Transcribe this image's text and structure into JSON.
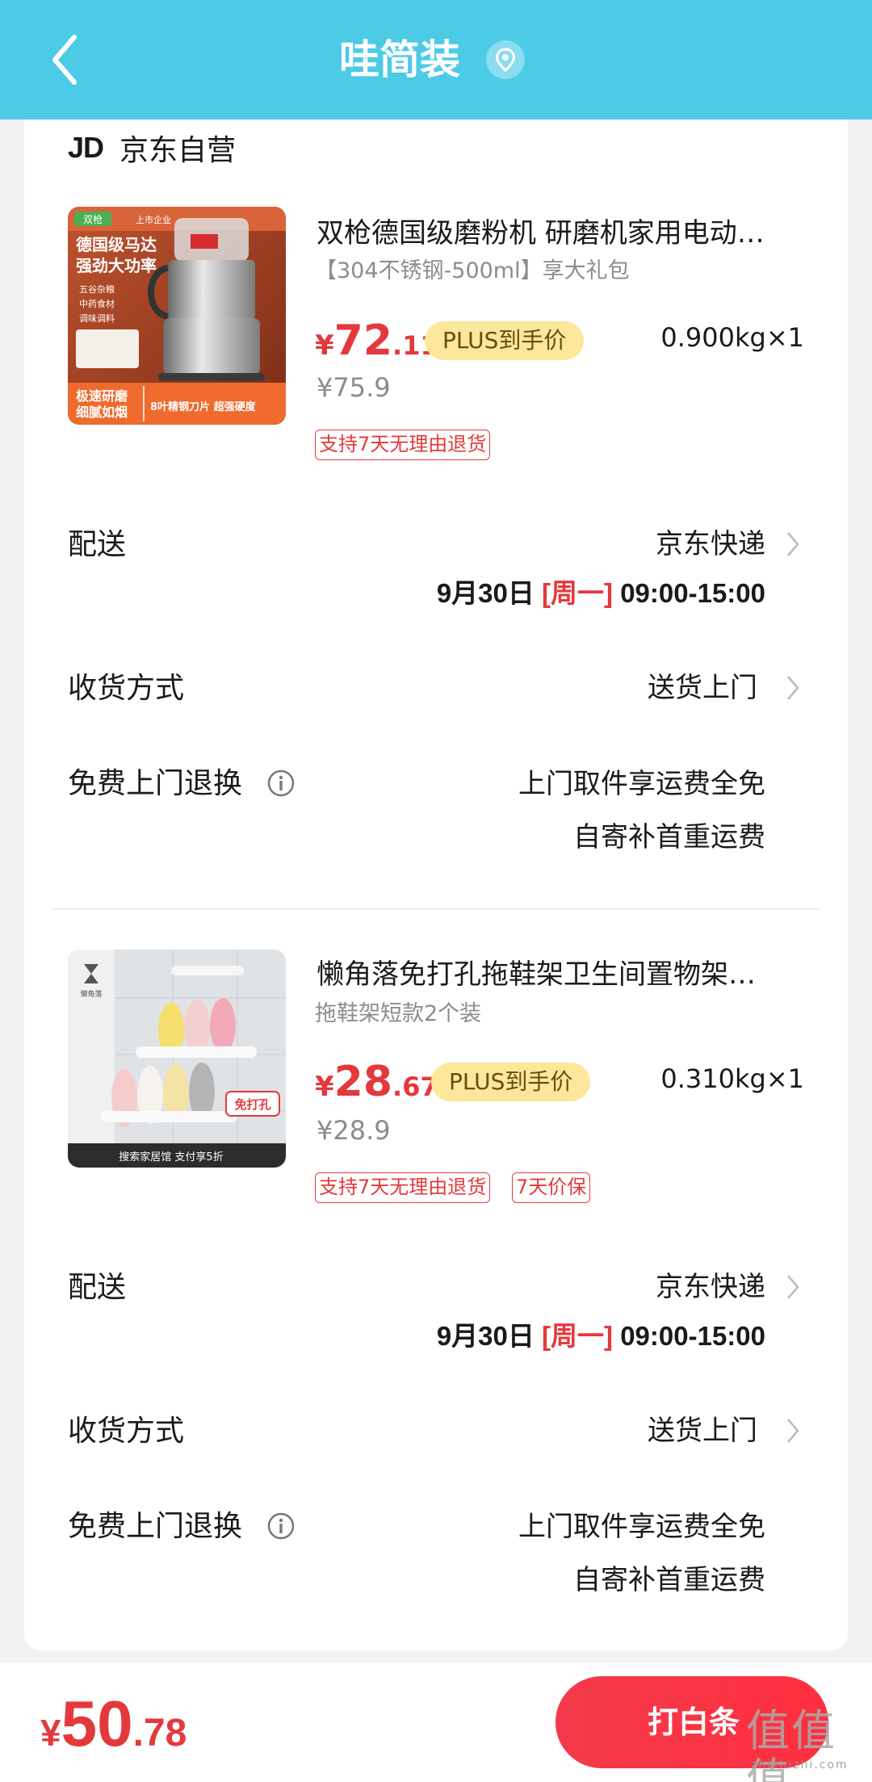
{
  "header": {
    "title": "哇简装",
    "back_icon": "chevron-left-icon",
    "location_icon": "location-pin-icon",
    "background_color": "#4ccbe6"
  },
  "shop": {
    "logo_text": "JD",
    "name": "京东自营"
  },
  "products": [
    {
      "title": "双枪德国级磨粉机 研磨机家用电动…",
      "spec": "【304不锈钢-500ml】享大礼包",
      "price_currency": "¥",
      "price_int": "72",
      "price_dec": ".11",
      "plus_badge": "PLUS到手价",
      "original_price": "¥75.9",
      "weight_qty": "0.900kg×1",
      "tags": [
        "支持7天无理由退货"
      ],
      "image_texts": {
        "brand": "双枪",
        "corner": "上市企业",
        "headline_1": "德国级马达",
        "headline_2": "强劲大功率",
        "features": [
          "五谷杂粮",
          "中药食材",
          "调味调料"
        ],
        "footer_left_1": "极速研磨",
        "footer_left_2": "细腻如烟",
        "footer_right": "8叶精钢刀片 超强硬度"
      },
      "delivery": {
        "label": "配送",
        "carrier": "京东快递",
        "date": "9月30日 ",
        "weekday": "[周一]",
        "time": " 09:00-15:00"
      },
      "receive": {
        "label": "收货方式",
        "value": "送货上门"
      },
      "free_return": {
        "label": "免费上门退换",
        "line1": "上门取件享运费全免",
        "line2": "自寄补首重运费"
      }
    },
    {
      "title": "懒角落免打孔拖鞋架卫生间置物架…",
      "spec": "拖鞋架短款2个装",
      "price_currency": "¥",
      "price_int": "28",
      "price_dec": ".67",
      "plus_badge": "PLUS到手价",
      "original_price": "¥28.9",
      "weight_qty": "0.310kg×1",
      "tags": [
        "支持7天无理由退货",
        "7天价保"
      ],
      "image_texts": {
        "brand": "懒角落",
        "sticker": "免打孔",
        "footer": "搜索家居馆 支付享5折"
      },
      "delivery": {
        "label": "配送",
        "carrier": "京东快递",
        "date": "9月30日 ",
        "weekday": "[周一]",
        "time": " 09:00-15:00"
      },
      "receive": {
        "label": "收货方式",
        "value": "送货上门"
      },
      "free_return": {
        "label": "免费上门退换",
        "line1": "上门取件享运费全免",
        "line2": "自寄补首重运费"
      }
    }
  ],
  "footer": {
    "total_currency": "¥",
    "total_int": "50",
    "total_dec": ".78",
    "pay_button": "打白条",
    "watermark": "值值值",
    "watermark_sub": "zhizhizhi.com"
  },
  "colors": {
    "accent_red": "#e4393c",
    "plus_badge_bg": "#fde79a"
  }
}
